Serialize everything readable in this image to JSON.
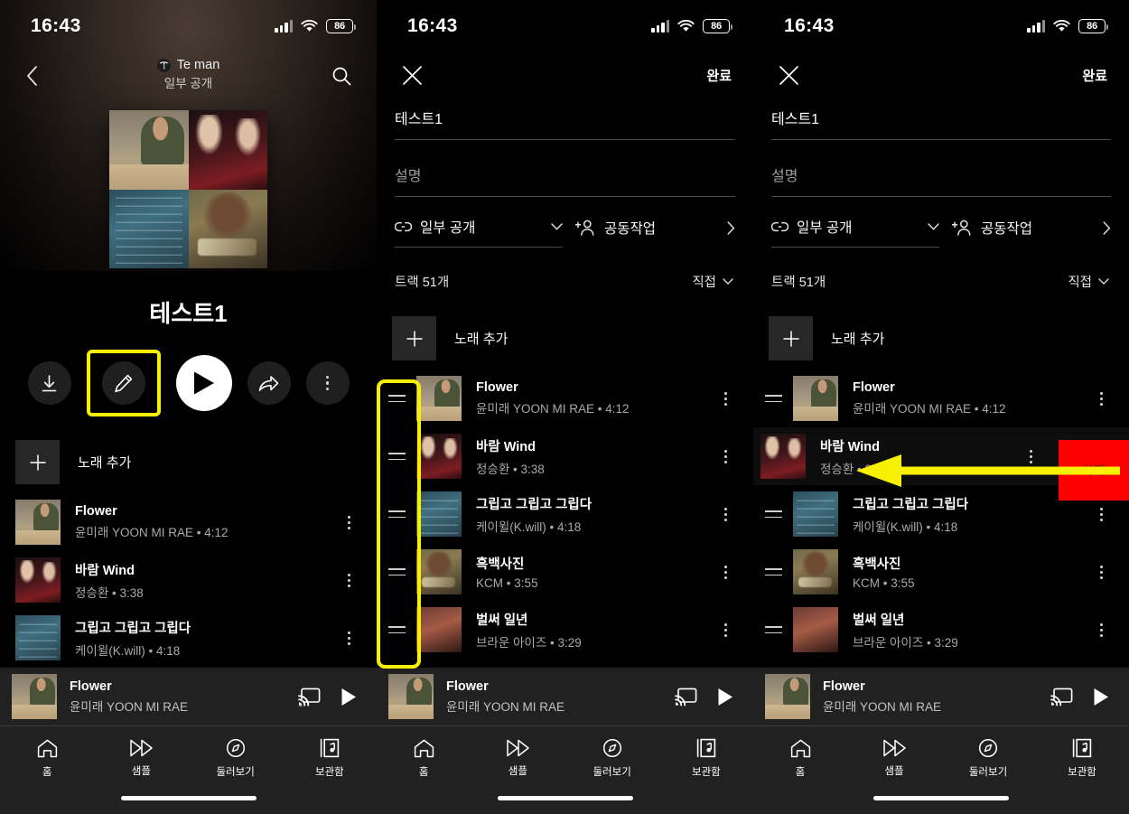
{
  "status_bar": {
    "time": "16:43",
    "battery": "86",
    "signal_icon": "cellular-bars-icon",
    "wifi_icon": "wifi-icon"
  },
  "panel1": {
    "back_icon": "chevron-left-icon",
    "search_icon": "search-icon",
    "owner": "Te man",
    "visibility": "일부 공개",
    "playlist_name": "테스트1",
    "actions": {
      "download": "download-icon",
      "edit": "pencil-icon",
      "play": "play-icon",
      "share": "share-icon",
      "more": "more-vertical-icon"
    },
    "add_song_label": "노래 추가",
    "tracks": [
      {
        "title": "Flower",
        "subtitle": "윤미래 YOON MI RAE • 4:12",
        "art": "art-flower"
      },
      {
        "title": "바람 Wind",
        "subtitle": "정승환 • 3:38",
        "art": "art-moon"
      },
      {
        "title": "그립고 그립고 그립다",
        "subtitle": "케이윌(K.will) • 4:18",
        "art": "art-kwill"
      }
    ]
  },
  "panel2": {
    "close_icon": "close-icon",
    "done_label": "완료",
    "name_value": "테스트1",
    "description_placeholder": "설명",
    "visibility_label": "일부 공개",
    "visibility_icon": "link-icon",
    "collab_label": "공동작업",
    "collab_icon": "person-add-icon",
    "track_count_label": "트랙 51개",
    "sort_label": "직접",
    "add_song_label": "노래 추가",
    "tracks": [
      {
        "title": "Flower",
        "subtitle": "윤미래 YOON MI RAE • 4:12",
        "art": "art-flower"
      },
      {
        "title": "바람 Wind",
        "subtitle": "정승환 • 3:38",
        "art": "art-moon"
      },
      {
        "title": "그립고 그립고 그립다",
        "subtitle": "케이윌(K.will) • 4:18",
        "art": "art-kwill"
      },
      {
        "title": "흑백사진",
        "subtitle": "KCM • 3:55",
        "art": "art-kcm"
      },
      {
        "title": "벌써 일년",
        "subtitle": "브라운 아이즈 • 3:29",
        "art": "art-brown"
      }
    ]
  },
  "panel3": {
    "close_icon": "close-icon",
    "done_label": "완료",
    "name_value": "테스트1",
    "description_placeholder": "설명",
    "visibility_label": "일부 공개",
    "visibility_icon": "link-icon",
    "collab_label": "공동작업",
    "collab_icon": "person-add-icon",
    "track_count_label": "트랙 51개",
    "sort_label": "직접",
    "add_song_label": "노래 추가",
    "delete_label": "삭제",
    "tracks": [
      {
        "title": "Flower",
        "subtitle": "윤미래 YOON MI RAE • 4:12",
        "art": "art-flower"
      },
      {
        "title": "바람 Wind",
        "subtitle": "정승환 • 3:38",
        "art": "art-moon"
      },
      {
        "title": "그립고 그립고 그립다",
        "subtitle": "케이윌(K.will) • 4:18",
        "art": "art-kwill"
      },
      {
        "title": "흑백사진",
        "subtitle": "KCM • 3:55",
        "art": "art-kcm"
      },
      {
        "title": "벌써 일년",
        "subtitle": "브라운 아이즈 • 3:29",
        "art": "art-brown"
      }
    ]
  },
  "mini_player": {
    "title": "Flower",
    "artist": "윤미래 YOON MI RAE",
    "cast_icon": "cast-icon",
    "play_icon": "play-icon"
  },
  "bottom_nav": [
    {
      "label": "홈",
      "icon": "home-icon"
    },
    {
      "label": "샘플",
      "icon": "samples-icon"
    },
    {
      "label": "둘러보기",
      "icon": "compass-icon"
    },
    {
      "label": "보관함",
      "icon": "library-icon"
    }
  ],
  "annotations": {
    "highlight_color": "#f7f000",
    "edit_button_highlight": "pencil-button-highlight",
    "drag_handles_highlight": "drag-handles-highlight",
    "delete_arrow": "swipe-delete-arrow"
  }
}
